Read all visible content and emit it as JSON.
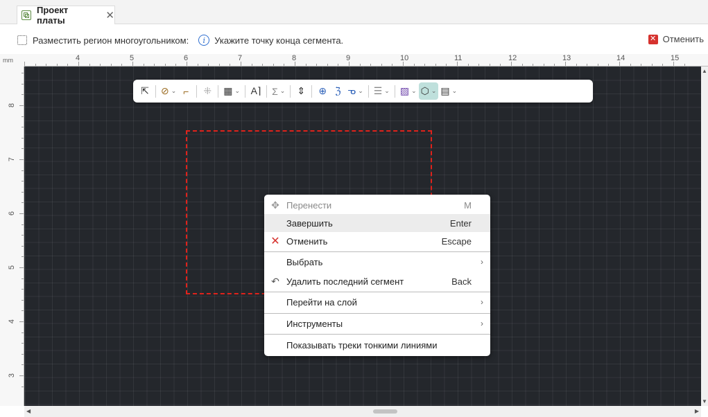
{
  "tab": {
    "title": "Проект платы",
    "close": "✕"
  },
  "status": {
    "command": "Разместить регион многоугольником:",
    "hint": "Укажите точку конца сегмента.",
    "cancel": "Отменить"
  },
  "ruler": {
    "unit": "mm",
    "top": [
      "4",
      "5",
      "6",
      "7",
      "8",
      "9",
      "10",
      "11",
      "12",
      "13",
      "14",
      "15"
    ],
    "left": [
      "8",
      "7",
      "6",
      "5",
      "4",
      "3"
    ]
  },
  "toolbar": {
    "icons": [
      "select-arrow-icon",
      "route-icon",
      "interactive-route-icon",
      "component-move-icon",
      "grid-icon",
      "text-icon",
      "sigma-icon",
      "via-icon",
      "target-icon",
      "diff-pair-icon",
      "probe-icon",
      "layer-stack-icon",
      "hatch-icon",
      "polygon-region-icon",
      "board-icon"
    ]
  },
  "menu": {
    "items": [
      {
        "label": "Перенести",
        "key": "M",
        "icon": "move-icon",
        "disabled": true
      },
      {
        "label": "Завершить",
        "key": "Enter",
        "hover": true
      },
      {
        "label": "Отменить",
        "key": "Escape",
        "icon": "cancel-icon"
      },
      {
        "label": "Выбрать",
        "submenu": true
      },
      {
        "label": "Удалить последний сегмент",
        "key": "Back",
        "icon": "undo-icon"
      },
      {
        "label": "Перейти на слой",
        "submenu": true
      },
      {
        "label": "Инструменты",
        "submenu": true
      },
      {
        "label": "Показывать треки тонкими линиями"
      }
    ]
  },
  "colors": {
    "canvas": "#24272c",
    "region_outline": "#e0221b",
    "active_tool": "#bfe0dc",
    "cancel": "#d6322e"
  }
}
